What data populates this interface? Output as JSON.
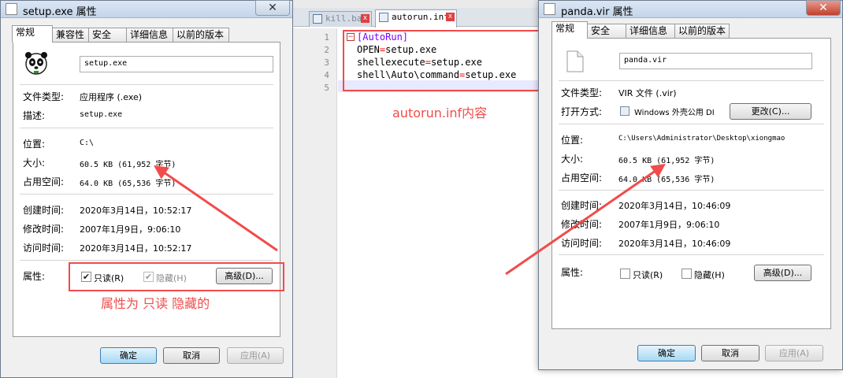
{
  "left_dialog": {
    "title": "setup.exe 属性",
    "close_label": "✕",
    "tabs": [
      "常规",
      "兼容性",
      "安全",
      "详细信息",
      "以前的版本"
    ],
    "icon": "panda-icon",
    "filename": "setup.exe",
    "rows": {
      "type_label": "文件类型:",
      "type_value": "应用程序 (.exe)",
      "desc_label": "描述:",
      "desc_value": "setup.exe",
      "location_label": "位置:",
      "location_value": "C:\\",
      "size_label": "大小:",
      "size_value": "60.5 KB (61,952 字节)",
      "disk_label": "占用空间:",
      "disk_value": "64.0 KB (65,536 字节)",
      "created_label": "创建时间:",
      "created_value": "2020年3月14日，10:52:17",
      "modified_label": "修改时间:",
      "modified_value": "2007年1月9日，9:06:10",
      "accessed_label": "访问时间:",
      "accessed_value": "2020年3月14日，10:52:17"
    },
    "attributes_label": "属性:",
    "readonly_label": "只读(R)",
    "readonly_checked": true,
    "hidden_label": "隐藏(H)",
    "hidden_checked": true,
    "advanced_label": "高级(D)...",
    "ok_label": "确定",
    "cancel_label": "取消",
    "apply_label": "应用(A)",
    "annotation": "属性为 只读 隐藏的"
  },
  "editor": {
    "tabs": [
      {
        "label": "kill.bat",
        "active": false
      },
      {
        "label": "autorun.inf",
        "active": true
      }
    ],
    "tab_close": "x",
    "line_numbers": [
      "1",
      "2",
      "3",
      "4",
      "5"
    ],
    "lines": [
      {
        "key": "[AutoRun]",
        "eq": "",
        "value": ""
      },
      {
        "key": "OPEN",
        "eq": "=",
        "value": "setup.exe"
      },
      {
        "key": "shellexecute",
        "eq": "=",
        "value": "setup.exe"
      },
      {
        "key": "shell\\Auto\\command",
        "eq": "=",
        "value": "setup.exe"
      },
      {
        "key": "",
        "eq": "",
        "value": ""
      }
    ],
    "fold_marker": "−",
    "annotation": "autorun.inf内容"
  },
  "right_dialog": {
    "title": "panda.vir 属性",
    "close_label": "✕",
    "tabs": [
      "常规",
      "安全",
      "详细信息",
      "以前的版本"
    ],
    "icon": "file-icon",
    "filename": "panda.vir",
    "rows": {
      "type_label": "文件类型:",
      "type_value": "VIR 文件 (.vir)",
      "open_label": "打开方式:",
      "open_value": "Windows 外壳公用 DI",
      "change_label": "更改(C)...",
      "location_label": "位置:",
      "location_value": "C:\\Users\\Administrator\\Desktop\\xiongmao",
      "size_label": "大小:",
      "size_value": "60.5 KB (61,952 字节)",
      "disk_label": "占用空间:",
      "disk_value": "64.0 KB (65,536 字节)",
      "created_label": "创建时间:",
      "created_value": "2020年3月14日，10:46:09",
      "modified_label": "修改时间:",
      "modified_value": "2007年1月9日，9:06:10",
      "accessed_label": "访问时间:",
      "accessed_value": "2020年3月14日，10:46:09"
    },
    "attributes_label": "属性:",
    "readonly_label": "只读(R)",
    "readonly_checked": false,
    "hidden_label": "隐藏(H)",
    "hidden_checked": false,
    "advanced_label": "高级(D)...",
    "ok_label": "确定",
    "cancel_label": "取消",
    "apply_label": "应用(A)"
  },
  "colors": {
    "annotation_red": "#f24b4b",
    "section_purple": "#8000ff",
    "equals_red": "#ff0000"
  }
}
